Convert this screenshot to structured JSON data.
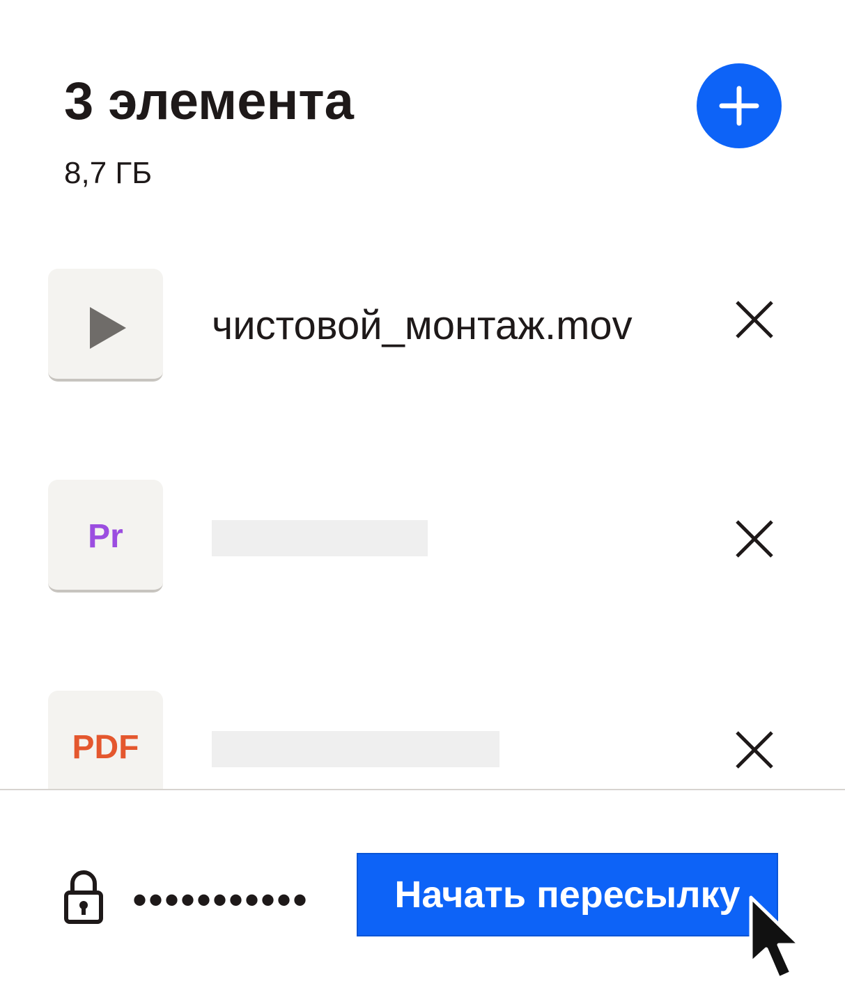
{
  "header": {
    "title": "3 элемента",
    "size": "8,7 ГБ",
    "add_icon": "plus-icon",
    "add_color": "#0d63f7"
  },
  "files": [
    {
      "icon": "play-icon",
      "name": "чистовой_монтаж.mov"
    },
    {
      "icon": "premiere-icon",
      "badge": "Pr",
      "name": ""
    },
    {
      "icon": "pdf-icon",
      "badge": "PDF",
      "name": ""
    }
  ],
  "footer": {
    "lock_icon": "lock-icon",
    "password_mask": "•••••••••••",
    "send_label": "Начать пересылку",
    "send_color": "#0d63f7"
  },
  "colors": {
    "accent": "#0d63f7",
    "premiere": "#9b4de0",
    "pdf": "#e4572e"
  }
}
